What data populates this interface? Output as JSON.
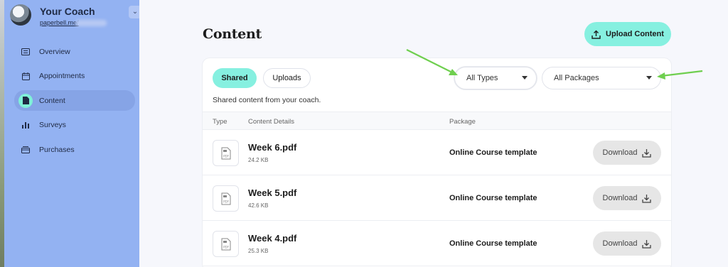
{
  "sidebar": {
    "brand_name": "Your Coach",
    "brand_url": "paperbell.me/",
    "items": [
      {
        "label": "Overview",
        "icon": "list-icon"
      },
      {
        "label": "Appointments",
        "icon": "calendar-icon"
      },
      {
        "label": "Content",
        "icon": "document-icon",
        "active": true
      },
      {
        "label": "Surveys",
        "icon": "bar-chart-icon"
      },
      {
        "label": "Purchases",
        "icon": "wallet-icon"
      }
    ]
  },
  "main": {
    "title": "Content",
    "upload_label": "Upload Content",
    "tabs": [
      {
        "label": "Shared",
        "active": true
      },
      {
        "label": "Uploads",
        "active": false
      }
    ],
    "subtitle": "Shared content from your coach.",
    "filters": {
      "type": "All Types",
      "package": "All Packages"
    },
    "columns": [
      "Type",
      "Content Details",
      "Package"
    ],
    "rows": [
      {
        "name": "Week 6.pdf",
        "size": "24.2 KB",
        "package": "Online Course template",
        "action": "Download",
        "icon": "pdf-file-icon"
      },
      {
        "name": "Week 5.pdf",
        "size": "42.6 KB",
        "package": "Online Course template",
        "action": "Download",
        "icon": "pdf-file-icon"
      },
      {
        "name": "Week 4.pdf",
        "size": "25.3 KB",
        "package": "Online Course template",
        "action": "Download",
        "icon": "pdf-file-icon"
      }
    ]
  },
  "colors": {
    "sidebar_bg": "#93b2f2",
    "accent": "#86f0e0",
    "annotation_arrow": "#6fcf4f"
  }
}
